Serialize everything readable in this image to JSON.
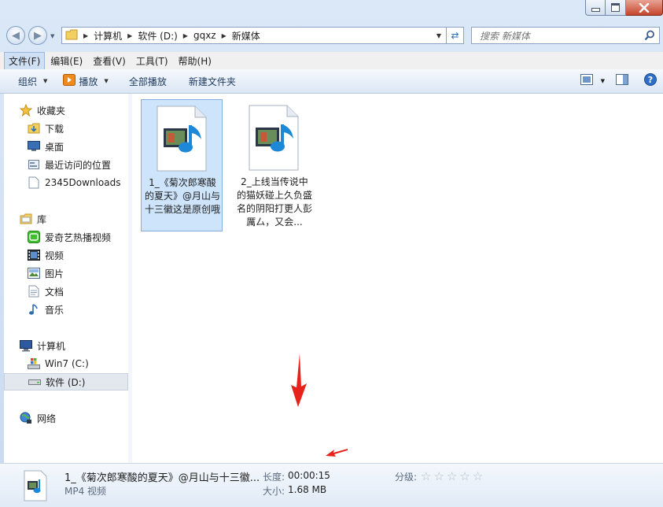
{
  "address": {
    "crumbs": [
      "计算机",
      "软件 (D:)",
      "gqxz",
      "新媒体"
    ]
  },
  "search": {
    "placeholder": "搜索 新媒体"
  },
  "menu": [
    "文件(F)",
    "编辑(E)",
    "查看(V)",
    "工具(T)",
    "帮助(H)"
  ],
  "toolbar": {
    "organize": "组织",
    "play": "播放",
    "play_all": "全部播放",
    "new_folder": "新建文件夹"
  },
  "nav": {
    "favorites": "收藏夹",
    "downloads": "下载",
    "desktop": "桌面",
    "recent": "最近访问的位置",
    "dl2345": "2345Downloads",
    "libraries": "库",
    "iqiyi": "爱奇艺热播视频",
    "videos": "视频",
    "pictures": "图片",
    "documents": "文档",
    "music": "音乐",
    "computer": "计算机",
    "drive_c": "Win7 (C:)",
    "drive_d": "软件 (D:)",
    "network": "网络"
  },
  "files": [
    {
      "name": "1_《菊次郎寒酸的夏天》@月山与十三徽这是原创哦"
    },
    {
      "name": "2_上线当传说中的猫妖碰上久负盛名的阴阳打更人彭厲厶，又会..."
    }
  ],
  "details": {
    "name": "1_《菊次郎寒酸的夏天》@月山与十三徽...",
    "type": "MP4 视频",
    "length_label": "长度:",
    "length": "00:00:15",
    "size_label": "大小:",
    "size": "1.68 MB",
    "rating_label": "分级:"
  },
  "colors": {
    "selection": "#cde4fb",
    "arrow": "#e8211b",
    "accent": "#2a6cb8"
  }
}
